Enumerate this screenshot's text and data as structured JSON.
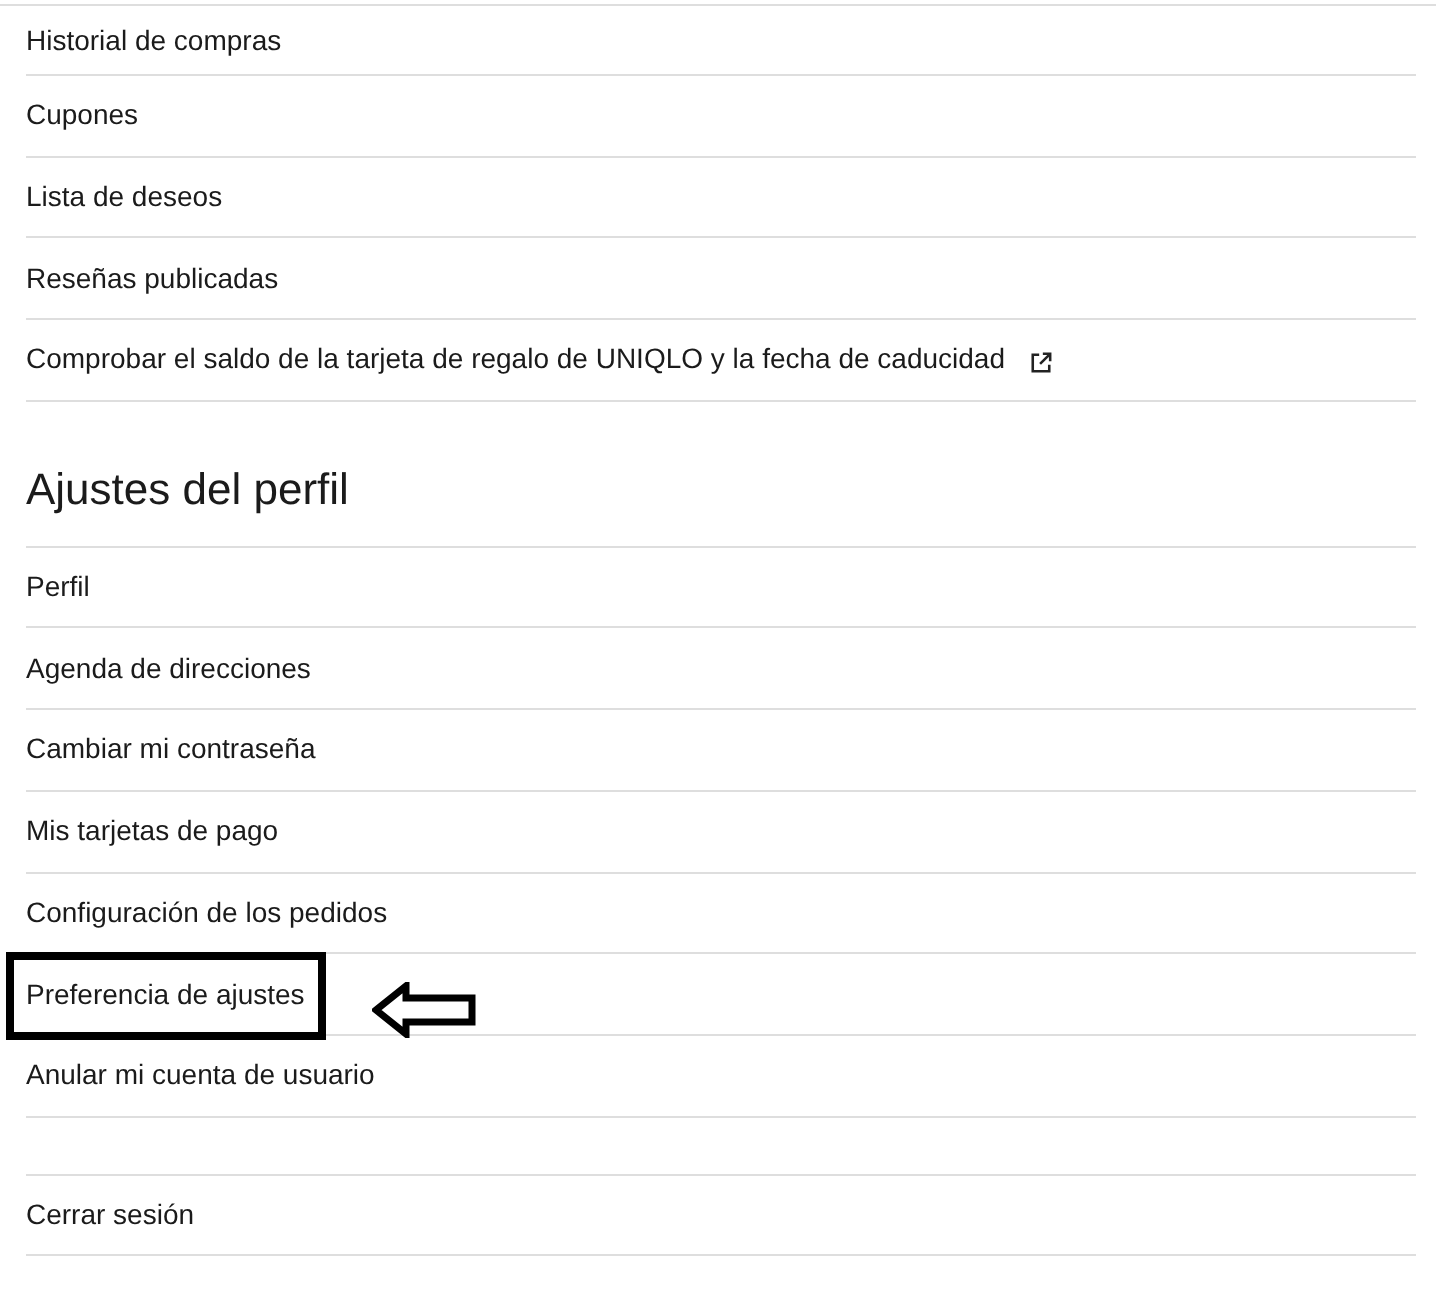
{
  "account_links": [
    {
      "label": "Historial de compras",
      "external": false
    },
    {
      "label": "Cupones",
      "external": false
    },
    {
      "label": "Lista de deseos",
      "external": false
    },
    {
      "label": "Reseñas publicadas",
      "external": false
    },
    {
      "label": "Comprobar el saldo de la tarjeta de regalo de UNIQLO y la fecha de caducidad",
      "external": true
    }
  ],
  "profile_settings": {
    "title": "Ajustes del perfil",
    "items": [
      {
        "label": "Perfil",
        "highlighted": false
      },
      {
        "label": "Agenda de direcciones",
        "highlighted": false
      },
      {
        "label": "Cambiar mi contraseña",
        "highlighted": false
      },
      {
        "label": "Mis tarjetas de pago",
        "highlighted": false
      },
      {
        "label": "Configuración de los pedidos",
        "highlighted": false
      },
      {
        "label": "Preferencia de ajustes",
        "highlighted": true
      },
      {
        "label": "Anular mi cuenta de usuario",
        "highlighted": false
      }
    ]
  },
  "logout": {
    "label": "Cerrar sesión"
  }
}
